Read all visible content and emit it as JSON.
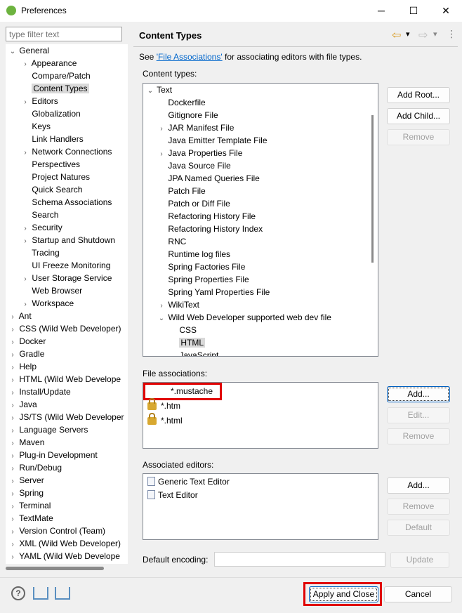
{
  "window": {
    "title": "Preferences",
    "minimize": "─",
    "maximize": "☐",
    "close": "✕"
  },
  "filter": {
    "placeholder": "type filter text"
  },
  "left_tree": [
    {
      "label": "General",
      "level": 0,
      "exp": "v"
    },
    {
      "label": "Appearance",
      "level": 1,
      "exp": ">"
    },
    {
      "label": "Compare/Patch",
      "level": 1,
      "exp": ""
    },
    {
      "label": "Content Types",
      "level": 1,
      "exp": "",
      "selected": true
    },
    {
      "label": "Editors",
      "level": 1,
      "exp": ">"
    },
    {
      "label": "Globalization",
      "level": 1,
      "exp": ""
    },
    {
      "label": "Keys",
      "level": 1,
      "exp": ""
    },
    {
      "label": "Link Handlers",
      "level": 1,
      "exp": ""
    },
    {
      "label": "Network Connections",
      "level": 1,
      "exp": ">"
    },
    {
      "label": "Perspectives",
      "level": 1,
      "exp": ""
    },
    {
      "label": "Project Natures",
      "level": 1,
      "exp": ""
    },
    {
      "label": "Quick Search",
      "level": 1,
      "exp": ""
    },
    {
      "label": "Schema Associations",
      "level": 1,
      "exp": ""
    },
    {
      "label": "Search",
      "level": 1,
      "exp": ""
    },
    {
      "label": "Security",
      "level": 1,
      "exp": ">"
    },
    {
      "label": "Startup and Shutdown",
      "level": 1,
      "exp": ">"
    },
    {
      "label": "Tracing",
      "level": 1,
      "exp": ""
    },
    {
      "label": "UI Freeze Monitoring",
      "level": 1,
      "exp": ""
    },
    {
      "label": "User Storage Service",
      "level": 1,
      "exp": ">"
    },
    {
      "label": "Web Browser",
      "level": 1,
      "exp": ""
    },
    {
      "label": "Workspace",
      "level": 1,
      "exp": ">"
    },
    {
      "label": "Ant",
      "level": 0,
      "exp": ">"
    },
    {
      "label": "CSS (Wild Web Developer)",
      "level": 0,
      "exp": ">"
    },
    {
      "label": "Docker",
      "level": 0,
      "exp": ">"
    },
    {
      "label": "Gradle",
      "level": 0,
      "exp": ">"
    },
    {
      "label": "Help",
      "level": 0,
      "exp": ">"
    },
    {
      "label": "HTML (Wild Web Develope",
      "level": 0,
      "exp": ">"
    },
    {
      "label": "Install/Update",
      "level": 0,
      "exp": ">"
    },
    {
      "label": "Java",
      "level": 0,
      "exp": ">"
    },
    {
      "label": "JS/TS (Wild Web Developer",
      "level": 0,
      "exp": ">"
    },
    {
      "label": "Language Servers",
      "level": 0,
      "exp": ">"
    },
    {
      "label": "Maven",
      "level": 0,
      "exp": ">"
    },
    {
      "label": "Plug-in Development",
      "level": 0,
      "exp": ">"
    },
    {
      "label": "Run/Debug",
      "level": 0,
      "exp": ">"
    },
    {
      "label": "Server",
      "level": 0,
      "exp": ">"
    },
    {
      "label": "Spring",
      "level": 0,
      "exp": ">"
    },
    {
      "label": "Terminal",
      "level": 0,
      "exp": ">"
    },
    {
      "label": "TextMate",
      "level": 0,
      "exp": ">"
    },
    {
      "label": "Version Control (Team)",
      "level": 0,
      "exp": ">"
    },
    {
      "label": "XML (Wild Web Developer)",
      "level": 0,
      "exp": ">"
    },
    {
      "label": "YAML (Wild Web Develope",
      "level": 0,
      "exp": ">"
    }
  ],
  "page": {
    "title": "Content Types",
    "see_prefix": "See ",
    "link": "'File Associations'",
    "see_suffix": " for associating editors with file types.",
    "content_types_label": "Content types:",
    "file_assoc_label": "File associations:",
    "assoc_editors_label": "Associated editors:",
    "encoding_label": "Default encoding:",
    "encoding_value": ""
  },
  "content_tree": [
    {
      "label": "Text",
      "level": 0,
      "exp": "v"
    },
    {
      "label": "Dockerfile",
      "level": 1,
      "exp": ""
    },
    {
      "label": "Gitignore File",
      "level": 1,
      "exp": ""
    },
    {
      "label": "JAR Manifest File",
      "level": 1,
      "exp": ">"
    },
    {
      "label": "Java Emitter Template File",
      "level": 1,
      "exp": ""
    },
    {
      "label": "Java Properties File",
      "level": 1,
      "exp": ">"
    },
    {
      "label": "Java Source File",
      "level": 1,
      "exp": ""
    },
    {
      "label": "JPA Named Queries File",
      "level": 1,
      "exp": ""
    },
    {
      "label": "Patch File",
      "level": 1,
      "exp": ""
    },
    {
      "label": "Patch or Diff File",
      "level": 1,
      "exp": ""
    },
    {
      "label": "Refactoring History File",
      "level": 1,
      "exp": ""
    },
    {
      "label": "Refactoring History Index",
      "level": 1,
      "exp": ""
    },
    {
      "label": "RNC",
      "level": 1,
      "exp": ""
    },
    {
      "label": "Runtime log files",
      "level": 1,
      "exp": ""
    },
    {
      "label": "Spring Factories File",
      "level": 1,
      "exp": ""
    },
    {
      "label": "Spring Properties File",
      "level": 1,
      "exp": ""
    },
    {
      "label": "Spring Yaml Properties File",
      "level": 1,
      "exp": ""
    },
    {
      "label": "WikiText",
      "level": 1,
      "exp": ">"
    },
    {
      "label": "Wild Web Developer supported web dev file",
      "level": 1,
      "exp": "v"
    },
    {
      "label": "CSS",
      "level": 2,
      "exp": ""
    },
    {
      "label": "HTML",
      "level": 2,
      "exp": "",
      "selected": true
    },
    {
      "label": "JavaScript",
      "level": 2,
      "exp": ""
    }
  ],
  "file_associations": [
    {
      "label": "*.mustache",
      "locked": false,
      "highlighted": true
    },
    {
      "label": "*.htm",
      "locked": true
    },
    {
      "label": "*.html",
      "locked": true
    }
  ],
  "editors": [
    {
      "label": "Generic Text Editor",
      "icon": "generic-editor-icon"
    },
    {
      "label": "Text Editor",
      "icon": "text-file-icon"
    }
  ],
  "buttons": {
    "add_root": "Add Root...",
    "add_child": "Add Child...",
    "remove": "Remove",
    "fa_add": "Add...",
    "fa_edit": "Edit...",
    "fa_remove": "Remove",
    "ed_add": "Add...",
    "ed_remove": "Remove",
    "ed_default": "Default",
    "update": "Update",
    "apply_close": "Apply and Close",
    "cancel": "Cancel"
  },
  "icons": {
    "help": "?",
    "back": "⇦",
    "forward": "⇨",
    "menu": "⋮",
    "dropdown": "▾"
  },
  "colors": {
    "link": "#0066cc",
    "highlight": "#e00000",
    "selection": "#d9d9d9"
  }
}
